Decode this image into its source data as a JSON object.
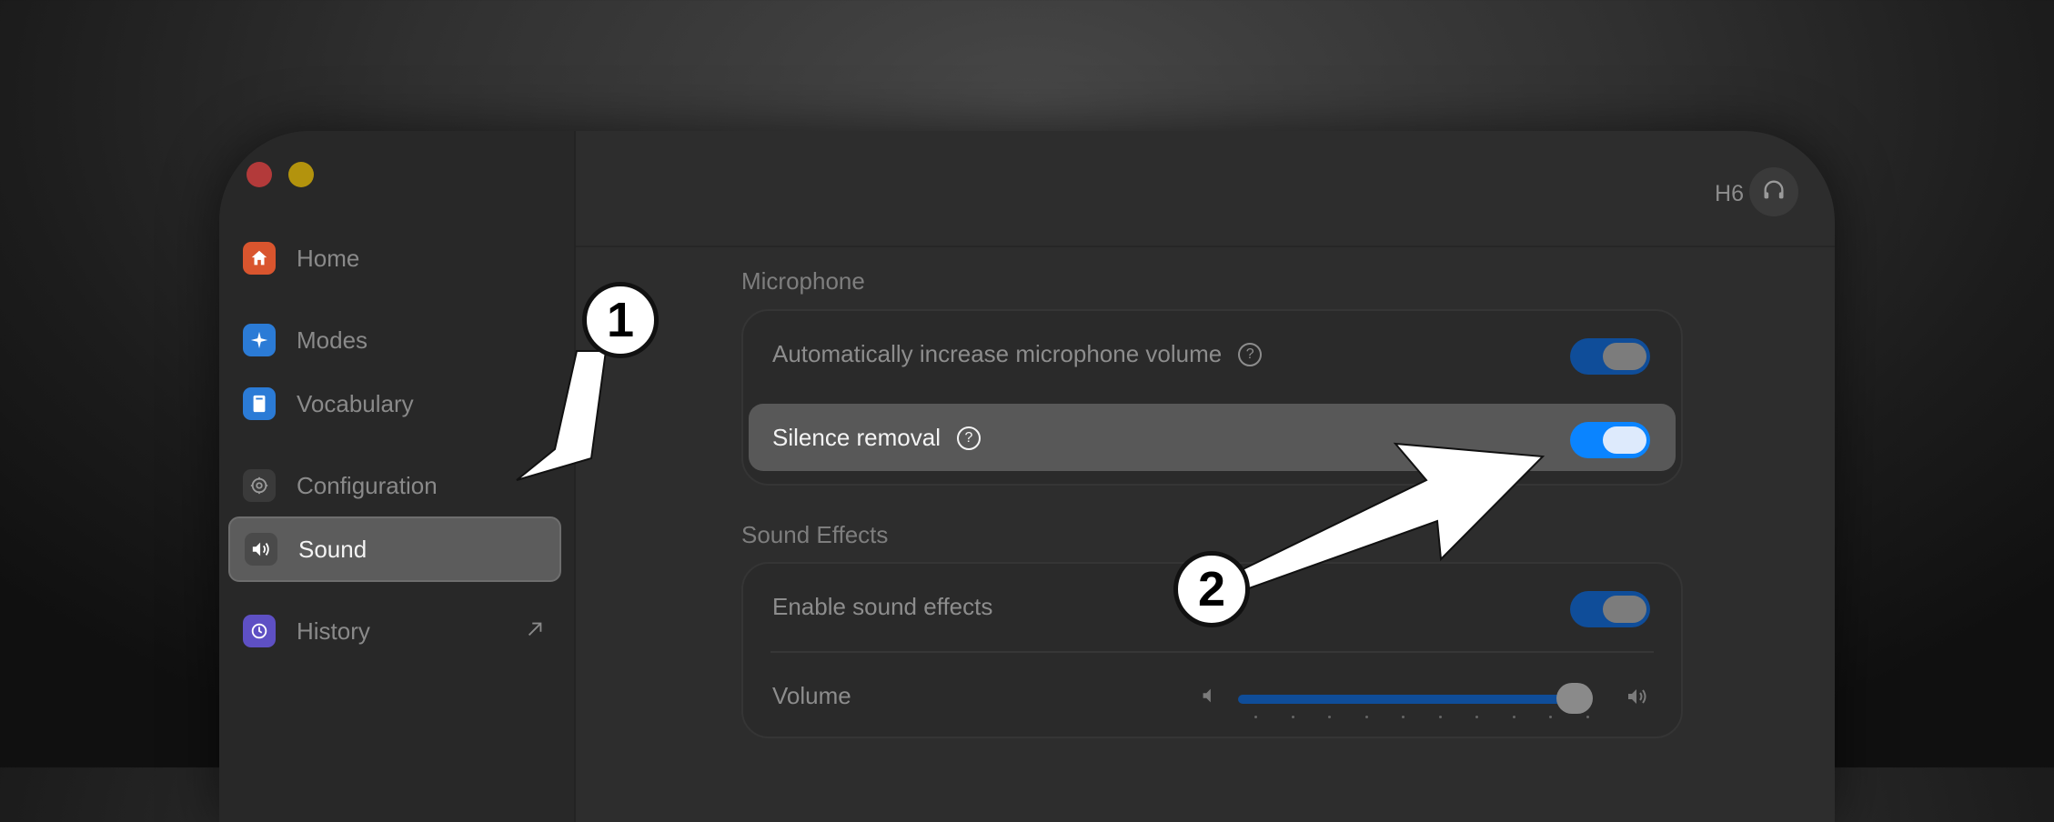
{
  "sidebar": {
    "items": [
      {
        "label": "Home",
        "icon": "house-icon",
        "color": "#d9552e"
      },
      {
        "label": "Modes",
        "icon": "sparkle-icon",
        "color": "#2b7bd6"
      },
      {
        "label": "Vocabulary",
        "icon": "book-icon",
        "color": "#2b7bd6"
      },
      {
        "label": "Configuration",
        "icon": "gear-icon",
        "color": "#3a3a3a"
      },
      {
        "label": "Sound",
        "icon": "speaker-icon",
        "color": "#4a4a4a",
        "active": true
      },
      {
        "label": "History",
        "icon": "history-icon",
        "color": "#5e50c4"
      }
    ]
  },
  "header": {
    "device": "H6",
    "device_icon": "headphones-icon"
  },
  "microphone": {
    "title": "Microphone",
    "auto_volume": {
      "label": "Automatically increase microphone volume",
      "enabled": true
    },
    "silence_removal": {
      "label": "Silence removal",
      "enabled": true
    }
  },
  "sound_effects": {
    "title": "Sound Effects",
    "enable": {
      "label": "Enable sound effects",
      "enabled": true
    },
    "volume": {
      "label": "Volume",
      "level": 1.0
    }
  },
  "annotations": {
    "badge1": "1",
    "badge2": "2"
  },
  "colors": {
    "accent": "#0a84ff",
    "toggle_dim": "#0f4d99"
  }
}
